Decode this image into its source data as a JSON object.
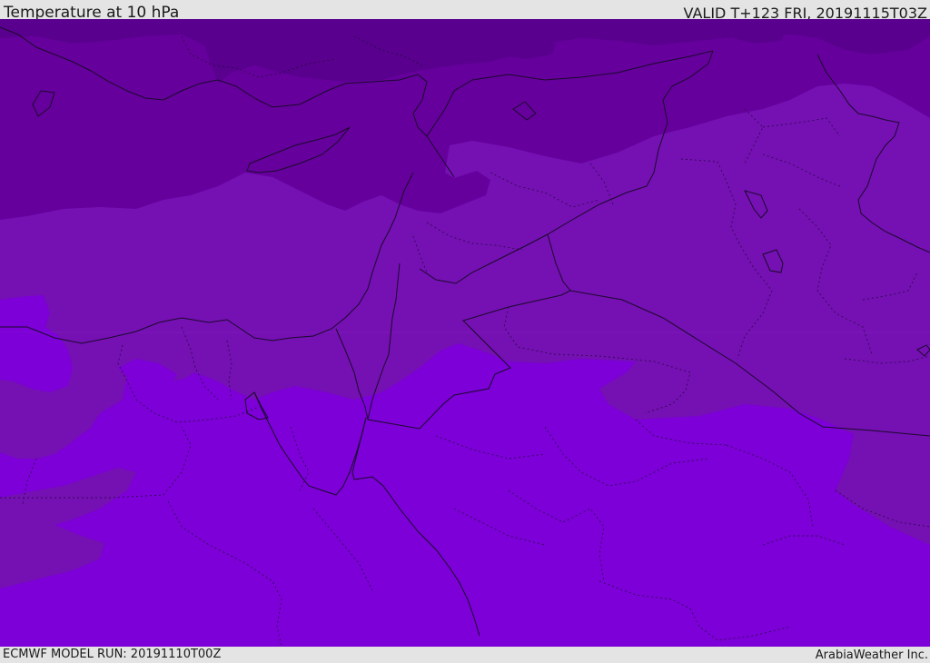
{
  "header": {
    "title": "Temperature at 10 hPa",
    "valid_time": "VALID T+123 FRI, 20191115T03Z"
  },
  "footer": {
    "model_run": "ECMWF MODEL RUN: 20191110T00Z",
    "credit": "ArabiaWeather Inc."
  },
  "colors": {
    "band_darkest": "#5a008f",
    "band_dark": "#66009d",
    "band_mid": "#7510b3",
    "band_light": "#7c00d7",
    "boundary": "#1a0a2a",
    "bar_bg": "#e4e4e4"
  }
}
